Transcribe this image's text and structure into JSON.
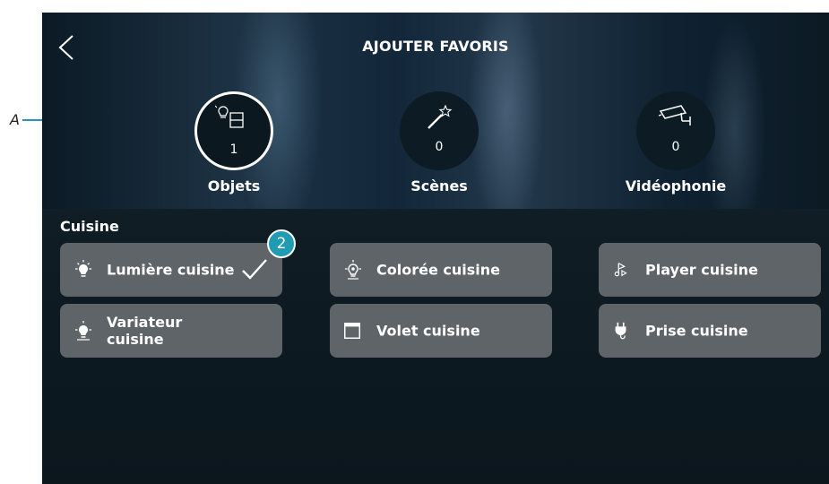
{
  "header": {
    "title": "AJOUTER FAVORIS",
    "back_icon": "chevron-left-icon"
  },
  "tabs": [
    {
      "label": "Objets",
      "count": "1",
      "icon": "bulb-shutter-icon",
      "selected": true
    },
    {
      "label": "Scènes",
      "count": "0",
      "icon": "magic-wand-icon",
      "selected": false
    },
    {
      "label": "Vidéophonie",
      "count": "0",
      "icon": "security-camera-icon",
      "selected": false
    }
  ],
  "section": {
    "title": "Cuisine",
    "tiles": [
      {
        "label": "Lumière cuisine",
        "icon": "light-bulb-icon",
        "checked": true
      },
      {
        "label": "Colorée cuisine",
        "icon": "color-light-icon",
        "checked": false
      },
      {
        "label": "Player cuisine",
        "icon": "music-note-icon",
        "checked": false
      },
      {
        "label": "Variateur cuisine",
        "icon": "dimmer-bulb-icon",
        "checked": false
      },
      {
        "label": "Volet cuisine",
        "icon": "shutter-icon",
        "checked": false
      },
      {
        "label": "Prise cuisine",
        "icon": "plug-icon",
        "checked": false
      }
    ]
  },
  "annotations": {
    "callout_label": "A",
    "step_badge": "2"
  },
  "colors": {
    "tile_bg": "#5e6467",
    "badge": "#1f9bb3",
    "background": "#0f1c24"
  }
}
